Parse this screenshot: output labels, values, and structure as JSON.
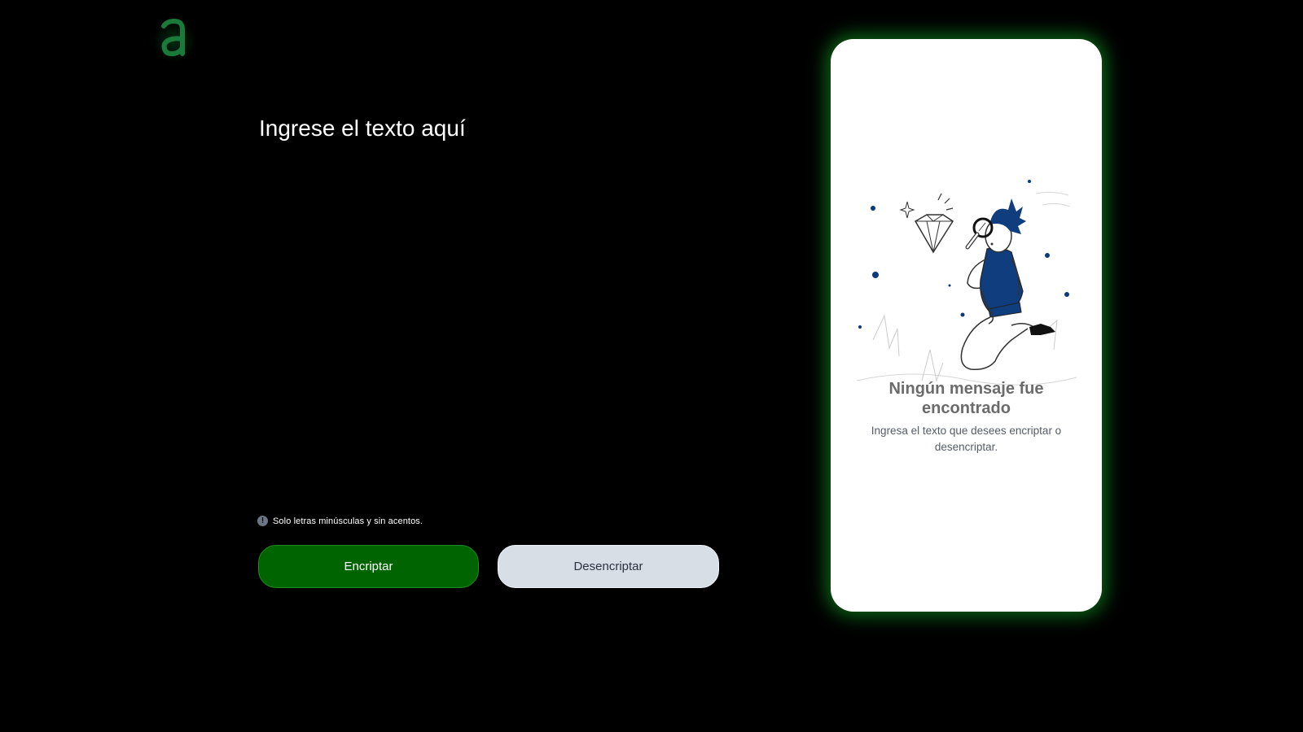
{
  "logo": {
    "glyph": "a",
    "color": "#1a7a3a"
  },
  "input": {
    "placeholder": "Ingrese el texto aquí",
    "value": ""
  },
  "hint": {
    "icon": "info-circle-icon",
    "text": "Solo letras minúsculas y sin acentos."
  },
  "buttons": {
    "encrypt_label": "Encriptar",
    "decrypt_label": "Desencriptar",
    "encrypt_color": "#006400",
    "decrypt_color": "#d8dee6"
  },
  "result": {
    "illustration": "person-with-magnifying-glass-and-diamond-illustration",
    "title": "Ningún mensaje fue encontrado",
    "subtitle": "Ingresa el texto que desees encriptar o desencriptar.",
    "glow_color": "#14b428"
  },
  "colors": {
    "background": "#000000",
    "accent_navy": "#0a3a7a"
  }
}
